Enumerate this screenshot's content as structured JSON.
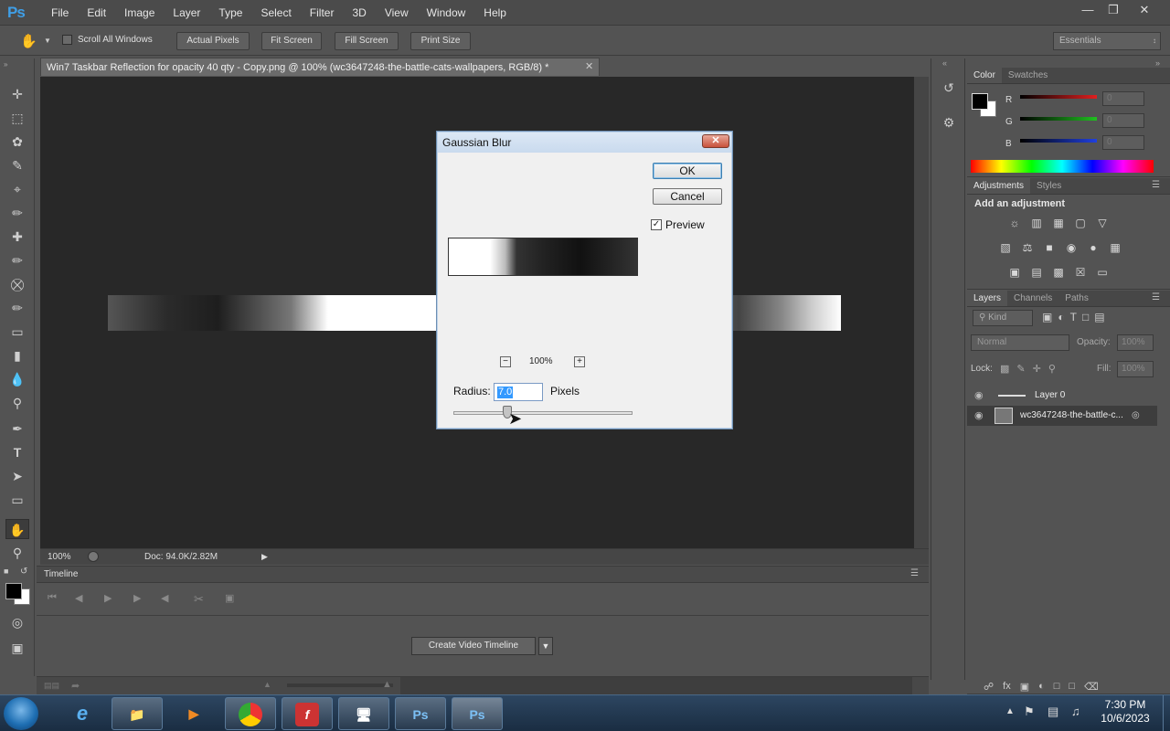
{
  "app": {
    "logo": "Ps",
    "window_controls": [
      "minimize",
      "restore",
      "close"
    ]
  },
  "menubar": {
    "items": [
      "File",
      "Edit",
      "Image",
      "Layer",
      "Type",
      "Select",
      "Filter",
      "3D",
      "View",
      "Window",
      "Help"
    ]
  },
  "options": {
    "scroll_all_windows": "Scroll All Windows",
    "buttons": [
      "Actual Pixels",
      "Fit Screen",
      "Fill Screen",
      "Print Size"
    ],
    "workspace": "Essentials"
  },
  "document": {
    "tab_title": "Win7 Taskbar Reflection  for opacity 40 qty  - Copy.png @ 100% (wc3647248-the-battle-cats-wallpapers, RGB/8) *",
    "zoom": "100%",
    "doc_info": "Doc: 94.0K/2.82M"
  },
  "timeline": {
    "title": "Timeline",
    "create_button": "Create Video Timeline"
  },
  "color_panel": {
    "tabs": [
      "Color",
      "Swatches"
    ],
    "channels": [
      {
        "label": "R",
        "value": "0",
        "color": "#e02020"
      },
      {
        "label": "G",
        "value": "0",
        "color": "#20c020"
      },
      {
        "label": "B",
        "value": "0",
        "color": "#2040e0"
      }
    ]
  },
  "adjustments_panel": {
    "tabs": [
      "Adjustments",
      "Styles"
    ],
    "heading": "Add an adjustment"
  },
  "layers_panel": {
    "tabs": [
      "Layers",
      "Channels",
      "Paths"
    ],
    "filter_kind": "Kind",
    "blend_mode": "Normal",
    "opacity_label": "Opacity:",
    "opacity_value": "100%",
    "lock_label": "Lock:",
    "fill_label": "Fill:",
    "fill_value": "100%",
    "layers": [
      {
        "name": "Layer 0",
        "selected": false
      },
      {
        "name": "wc3647248-the-battle-c...",
        "selected": true
      }
    ]
  },
  "dialog": {
    "title": "Gaussian Blur",
    "ok": "OK",
    "cancel": "Cancel",
    "preview_label": "Preview",
    "preview_checked": true,
    "zoom": "100%",
    "radius_label": "Radius:",
    "radius_value": "7.0",
    "units": "Pixels",
    "radius_slider_fraction": 0.3
  },
  "taskbar": {
    "apps": [
      "Internet Explorer",
      "Explorer",
      "Media Player",
      "Chrome",
      "Flash",
      "Network",
      "Ps",
      "Ps"
    ],
    "time": "7:30 PM",
    "date": "10/6/2023"
  }
}
